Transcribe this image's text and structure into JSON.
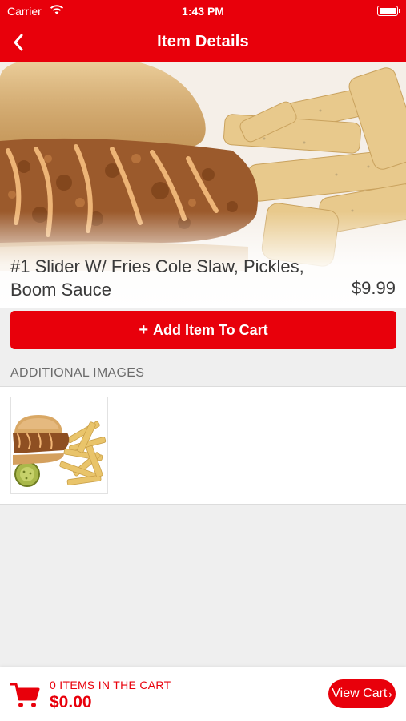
{
  "status_bar": {
    "carrier": "Carrier",
    "time": "1:43 PM"
  },
  "nav": {
    "title": "Item Details"
  },
  "item": {
    "name": "#1 Slider W/ Fries Cole Slaw, Pickles, Boom Sauce",
    "price": "$9.99",
    "add_to_cart_label": "Add Item To Cart"
  },
  "additional_images": {
    "header": "ADDITIONAL IMAGES"
  },
  "cart": {
    "items_label": "0 ITEMS IN THE CART",
    "total": "$0.00",
    "view_cart_label": "View Cart"
  },
  "colors": {
    "brand": "#e8000b",
    "text": "#3a3a3a",
    "muted": "#6b6b6b"
  },
  "icons": [
    "back-chevron-icon",
    "wifi-icon",
    "battery-icon",
    "plus-icon",
    "shopping-cart-icon",
    "chevron-right-icon"
  ]
}
